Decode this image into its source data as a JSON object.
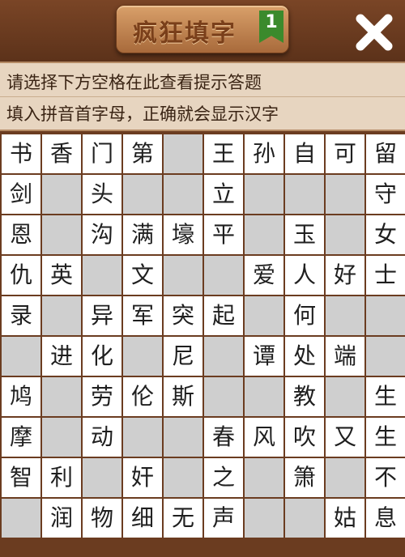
{
  "header": {
    "title": "疯狂填字",
    "level": "1",
    "close_icon": "close-x-icon"
  },
  "hint": {
    "line1": "请选择下方空格在此查看提示答题",
    "line2": "填入拼音首字母，正确就会显示汉字"
  },
  "colors": {
    "background": "#6b3c20",
    "letter_cell": "#ffffff",
    "blank_cell": "#cfcfcf",
    "hint_panel": "#e7d5c0",
    "badge": "#3b8a2c"
  },
  "grid": {
    "rows": [
      [
        "书",
        "香",
        "门",
        "第",
        "",
        "王",
        "孙",
        "自",
        "可",
        "留"
      ],
      [
        "剑",
        "",
        "头",
        "",
        "",
        "立",
        "",
        "",
        "",
        "守"
      ],
      [
        "恩",
        "",
        "沟",
        "满",
        "壕",
        "平",
        "",
        "玉",
        "",
        "女"
      ],
      [
        "仇",
        "英",
        "",
        "文",
        "",
        "",
        "爱",
        "人",
        "好",
        "士"
      ],
      [
        "录",
        "",
        "异",
        "军",
        "突",
        "起",
        "",
        "何",
        "",
        ""
      ],
      [
        "",
        "进",
        "化",
        "",
        "尼",
        "",
        "谭",
        "处",
        "端",
        ""
      ],
      [
        "鸠",
        "",
        "劳",
        "伦",
        "斯",
        "",
        "",
        "教",
        "",
        "生"
      ],
      [
        "摩",
        "",
        "动",
        "",
        "",
        "春",
        "风",
        "吹",
        "又",
        "生"
      ],
      [
        "智",
        "利",
        "",
        "奸",
        "",
        "之",
        "",
        "箫",
        "",
        "不"
      ],
      [
        "",
        "润",
        "物",
        "细",
        "无",
        "声",
        "",
        "",
        "姑",
        "息"
      ]
    ]
  }
}
